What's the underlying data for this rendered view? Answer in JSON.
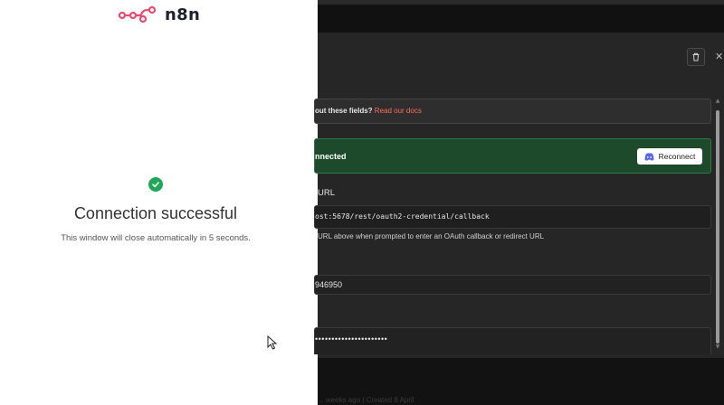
{
  "popup": {
    "brand": "n8n",
    "success_title": "Connection successful",
    "success_subtitle": "This window will close automatically in 5 seconds."
  },
  "credential_modal": {
    "info": {
      "prefix": "out these fields?",
      "link": "Read our docs"
    },
    "connected_text": "nnected",
    "reconnect_label": "Reconnect",
    "redirect_label": "URL",
    "redirect_url": "ost:5678/rest/oauth2-credential/callback",
    "redirect_help": "URL above when prompted to enter an OAuth callback or redirect URL",
    "client_id_value": "946950",
    "client_secret_value": "••••••••••••••••••••••",
    "footer_text": "... weeks ago | Created 8 April"
  },
  "icons": {
    "success": "check-circle-icon",
    "delete": "trash-icon",
    "close": "close-icon",
    "discord": "discord-icon",
    "cursor": "mouse-pointer-icon"
  },
  "colors": {
    "brand": "#ea4b71",
    "success": "#1fa85a",
    "connected_bg": "#1d4a2a",
    "link": "#ff6d5a"
  }
}
